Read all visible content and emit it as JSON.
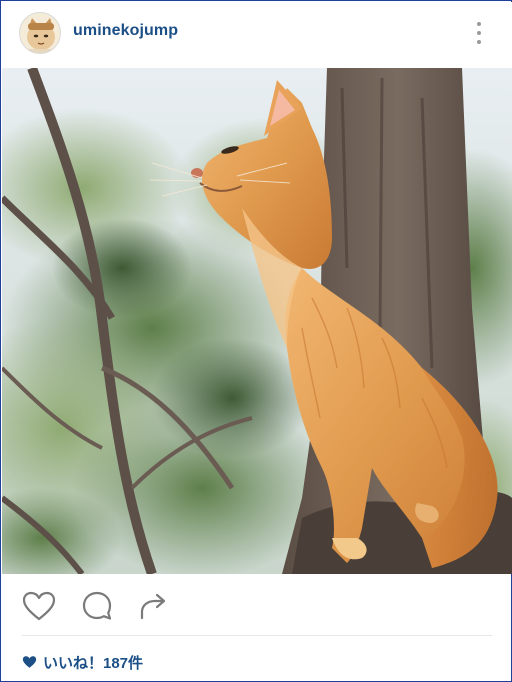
{
  "post": {
    "username": "uminekojump",
    "likes_text": "いいね！187件"
  },
  "icons": {
    "avatar": "cat-avatar-icon",
    "more": "vertical-ellipsis-icon",
    "like": "heart-outline-icon",
    "comment": "comment-bubble-icon",
    "share": "share-arrow-icon",
    "likes": "heart-filled-icon"
  },
  "colors": {
    "username": "#1b4f86",
    "likes": "#1b4f86",
    "icon": "#7a7a7a",
    "border": "#1f3f9a"
  }
}
